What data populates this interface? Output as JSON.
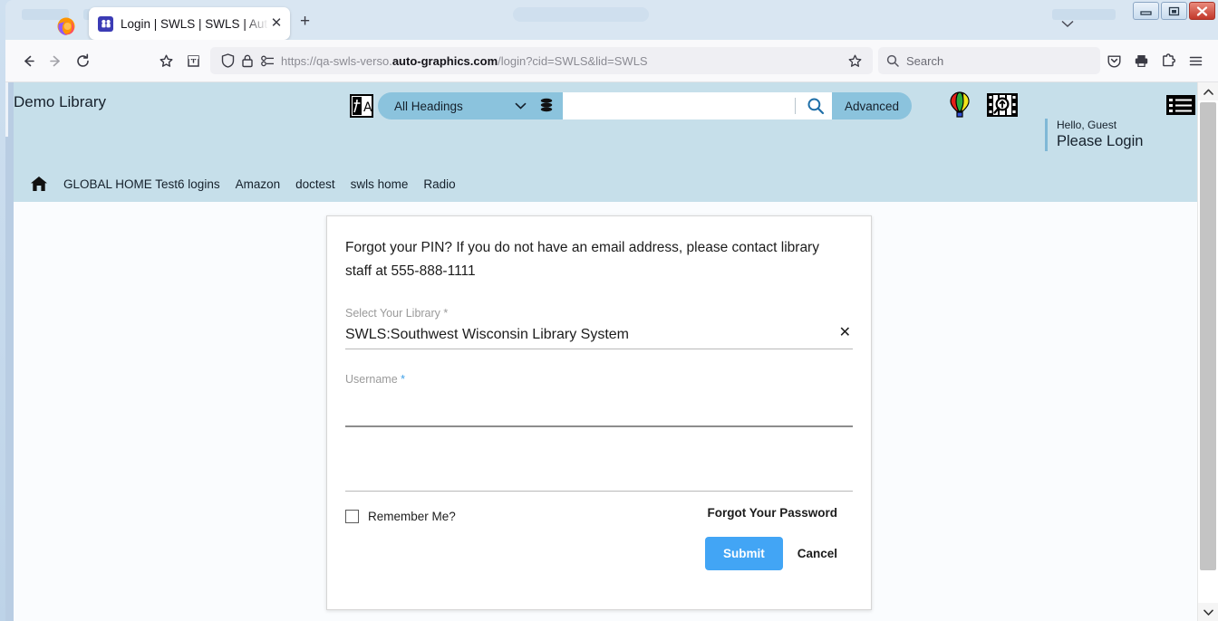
{
  "browser": {
    "tab": {
      "title": "Login | SWLS | SWLS | Auto-Graphics",
      "favicon_name": "ag-favicon",
      "close_label": "✕"
    },
    "newtab_label": "+",
    "toolbar": {
      "back_icon": "back-arrow-icon",
      "forward_icon": "forward-arrow-icon",
      "reload_icon": "reload-icon",
      "bookmark_icon": "star-icon",
      "save_tab_icon": "save-to-collection-icon",
      "shield_icon": "shield-icon",
      "lock_icon": "lock-icon",
      "permissions_icon": "permissions-icon",
      "url_prefix": "https://qa-swls-verso.",
      "url_host": "auto-graphics.com",
      "url_suffix": "/login?cid=SWLS&lid=SWLS",
      "url_full": "https://qa-swls-verso.auto-graphics.com/login?cid=SWLS&lid=SWLS",
      "bookmark_star_icon": "star-outline-icon",
      "search_placeholder": "Search",
      "pocket_icon": "pocket-icon",
      "print_icon": "print-icon",
      "extensions_icon": "extensions-puzzle-icon",
      "menu_icon": "hamburger-menu-icon"
    },
    "window_controls": {
      "minimize": "minimize-icon",
      "restore": "restore-icon",
      "close": "close-icon"
    }
  },
  "site": {
    "title": "Demo Library",
    "lang_icon": "translate-icon",
    "search": {
      "scope_selected": "All Headings",
      "scope_chevron": "chevron-down-icon",
      "database_icon": "database-stack-icon",
      "query_value": "",
      "query_placeholder": "",
      "search_icon": "search-icon",
      "advanced_label": "Advanced"
    },
    "balloon_icon": "hot-air-balloon-icon",
    "film_search_icon": "image-search-icon",
    "list_icon": "list-view-icon",
    "account": {
      "greeting": "Hello, Guest",
      "login_prompt": "Please Login"
    },
    "nav": {
      "home_icon": "home-icon",
      "links": [
        "GLOBAL HOME Test6 logins",
        "Amazon",
        "doctest",
        "swls home",
        "Radio"
      ]
    },
    "colors": {
      "header_bg": "#c6dfea",
      "pill_bg": "#8bc3dd",
      "submit_bg": "#42a5f5",
      "required_blue": "#3fa0e8"
    }
  },
  "login_card": {
    "pin_note": "Forgot your PIN? If you do not have an email address, please contact library staff at 555-888-1111",
    "library_field": {
      "label": "Select Your Library",
      "required_mark": "*",
      "value": "SWLS:Southwest Wisconsin Library System",
      "clear_icon": "✕"
    },
    "username_field": {
      "label": "Username",
      "required_mark": "*",
      "value": ""
    },
    "password_field": {
      "label": "",
      "value": ""
    },
    "remember": {
      "label": "Remember Me?",
      "checked": false
    },
    "forgot_password_label": "Forgot Your Password",
    "submit_label": "Submit",
    "cancel_label": "Cancel"
  },
  "page_scrollbar": {
    "up_icon": "chevron-up-icon",
    "down_icon": "chevron-down-icon"
  }
}
